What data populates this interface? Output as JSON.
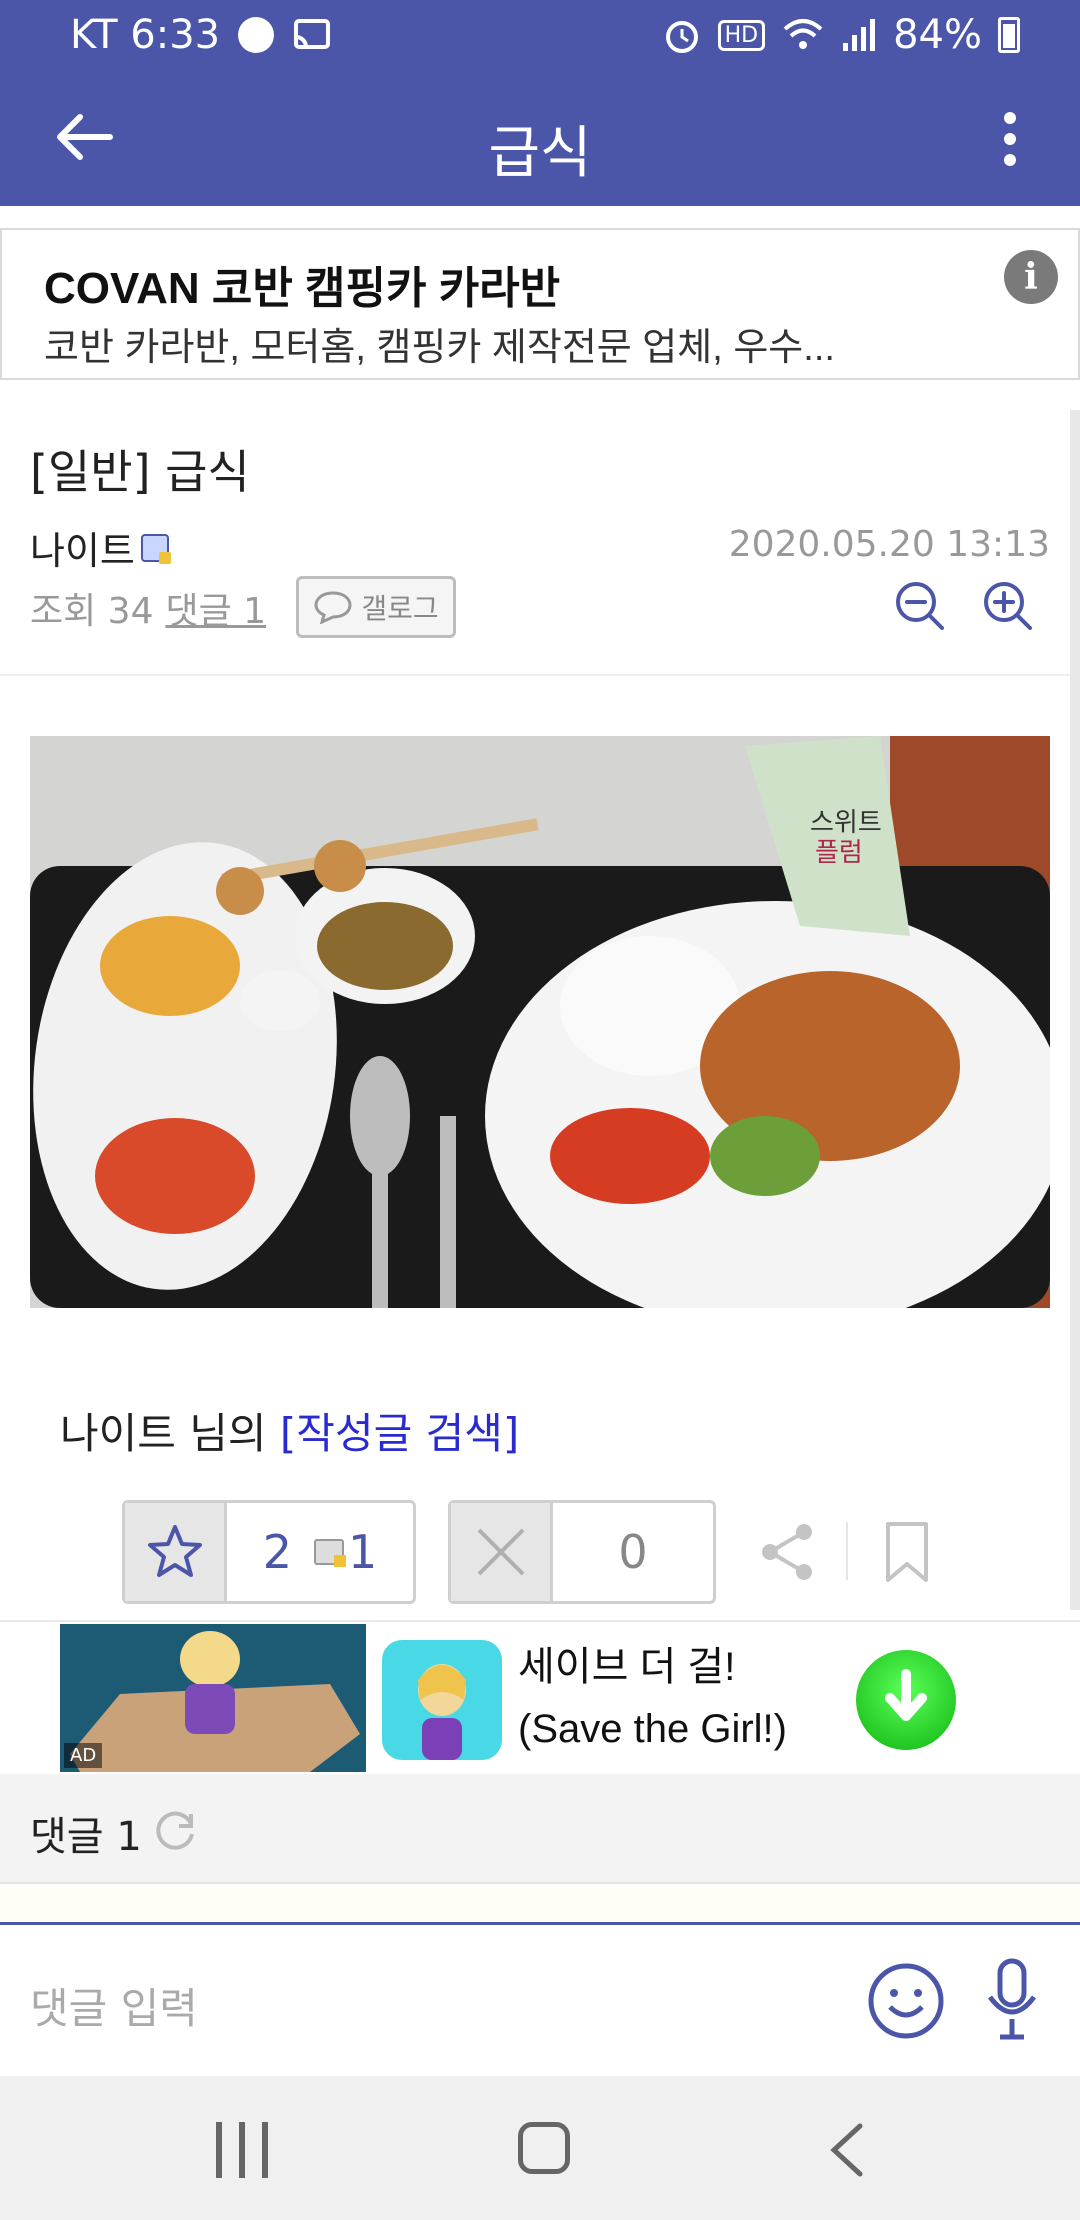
{
  "status_bar": {
    "carrier_time": "KT 6:33",
    "hd_label": "HD",
    "battery": "84%"
  },
  "header": {
    "title": "급식"
  },
  "ad_header": {
    "title": "COVAN 코반 캠핑카 카라반",
    "description": "코반 카라반, 모터홈, 캠핑카 제작전문 업체, 우수..."
  },
  "post": {
    "title": "[일반] 급식",
    "author": "나이트",
    "date": "2020.05.20 13:13",
    "views_label": "조회 34",
    "comments_link": "댓글 1",
    "gallog_label": "갤로그"
  },
  "author_search": {
    "prefix": "나이트 님의",
    "link": "[작성글 검색]"
  },
  "votes": {
    "recommend_count": "2",
    "fixed_recommend_count": "1",
    "not_recommend_count": "0"
  },
  "ad_banner": {
    "tag": "AD",
    "text": "세이브 더 걸! (Save the Girl!)"
  },
  "comments": {
    "header_label": "댓글 1",
    "input_placeholder": "댓글 입력"
  },
  "colors": {
    "brand": "#4b56a8",
    "link": "#2a2ad1",
    "muted": "#999999"
  },
  "icons": [
    "back-arrow-icon",
    "more-vert-icon",
    "info-icon",
    "zoom-out-icon",
    "zoom-in-icon",
    "chat-bubble-icon",
    "star-icon",
    "x-icon",
    "share-icon",
    "bookmark-icon",
    "download-icon",
    "refresh-icon",
    "emoji-icon",
    "mic-icon"
  ]
}
